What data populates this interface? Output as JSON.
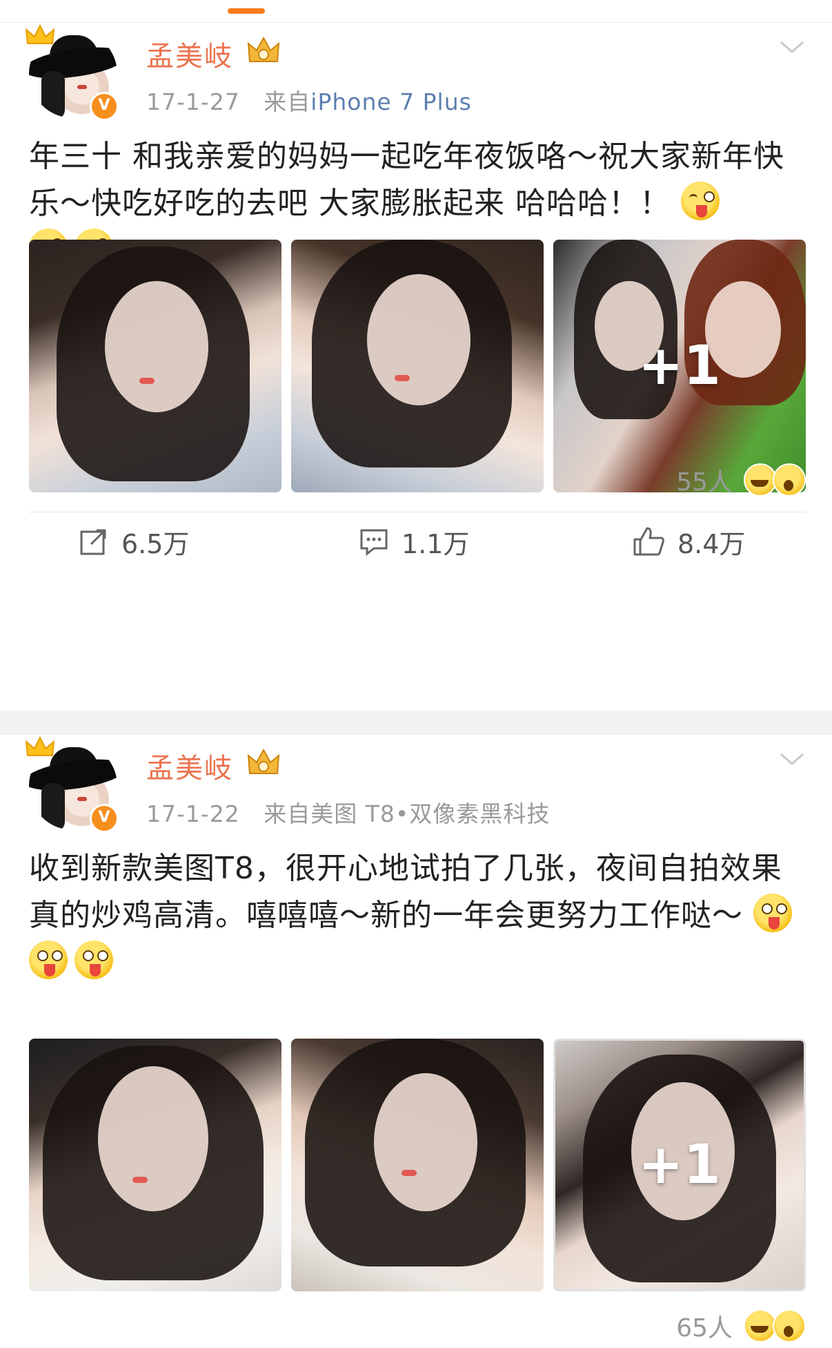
{
  "posts": [
    {
      "username": "孟美岐",
      "date": "17-1-27",
      "source_prefix": "来自",
      "source": "iPhone 7 Plus",
      "text": "年三十 和我亲爱的妈妈一起吃年夜饭咯～祝大家新年快乐～快吃好吃的去吧 大家膨胀起来 哈哈哈！！",
      "emoji_count": 3,
      "more_photos": "+1",
      "reactions_count": "55人",
      "reposts": "6.5万",
      "comments": "1.1万",
      "likes": "8.4万"
    },
    {
      "username": "孟美岐",
      "date": "17-1-22",
      "source_prefix": "来自",
      "source": "美图 T8•双像素黑科技",
      "text": "收到新款美图T8，很开心地试拍了几张，夜间自拍效果真的炒鸡高清。嘻嘻嘻～新的一年会更努力工作哒～",
      "emoji_count": 3,
      "more_photos": "+1",
      "reactions_count": "65人"
    }
  ],
  "colors": {
    "accent": "#f77b1e",
    "username": "#eb7350",
    "source_link": "#5b7fb0"
  }
}
